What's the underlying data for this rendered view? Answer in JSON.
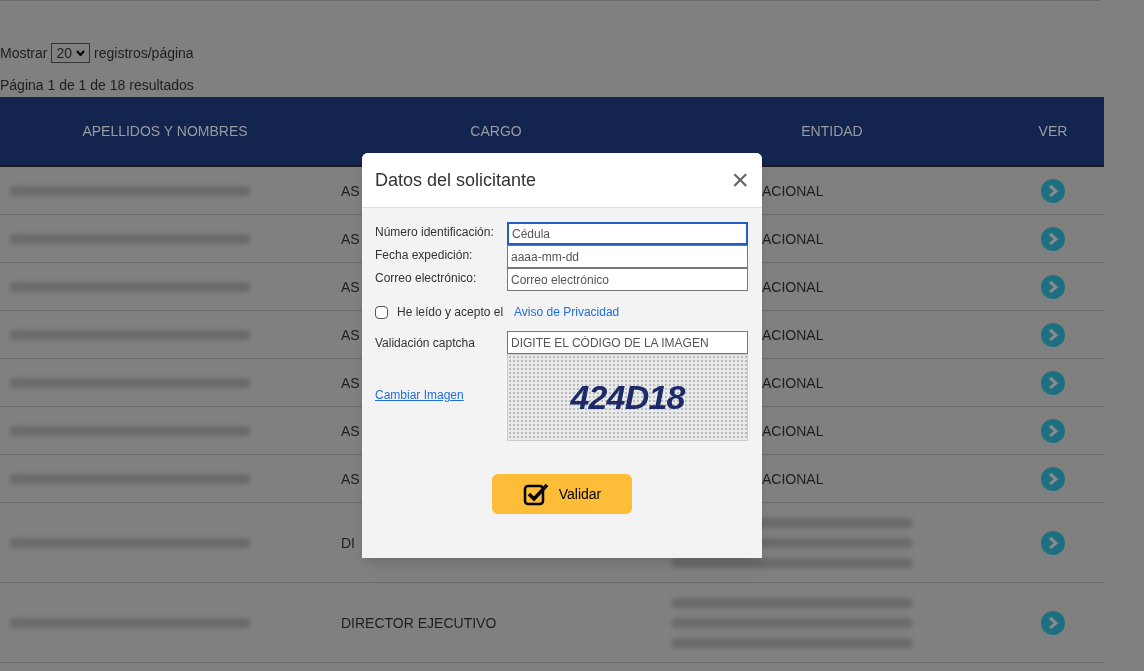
{
  "pager": {
    "show_label": "Mostrar",
    "page_size": "20",
    "per_page_label": "registros/página",
    "summary": "Página 1 de 1 de 18 resultados"
  },
  "table": {
    "columns": [
      "APELLIDOS Y NOMBRES",
      "CARGO",
      "ENTIDAD",
      "VER"
    ],
    "rows": [
      {
        "kind": "short",
        "cargo": "AS",
        "entidad": "ACIONAL"
      },
      {
        "kind": "short",
        "cargo": "AS",
        "entidad": "ACIONAL"
      },
      {
        "kind": "short",
        "cargo": "AS",
        "entidad": "ACIONAL"
      },
      {
        "kind": "short",
        "cargo": "AS",
        "entidad": "ACIONAL"
      },
      {
        "kind": "short",
        "cargo": "AS",
        "entidad": "ACIONAL"
      },
      {
        "kind": "short",
        "cargo": "AS",
        "entidad": "ACIONAL"
      },
      {
        "kind": "short",
        "cargo": "AS",
        "entidad": "ACIONAL"
      },
      {
        "kind": "tall",
        "cargo": "DI"
      },
      {
        "kind": "tall",
        "cargo": "DIRECTOR EJECUTIVO"
      }
    ]
  },
  "modal": {
    "title": "Datos del solicitante",
    "close": "×",
    "fields": [
      {
        "label": "Número identificación:",
        "placeholder": "Cédula",
        "focused": true
      },
      {
        "label": "Fecha expedición:",
        "placeholder": "aaaa-mm-dd",
        "focused": false
      },
      {
        "label": "Correo electrónico:",
        "placeholder": "Correo electrónico",
        "focused": false
      }
    ],
    "consent": {
      "checked": false,
      "text": "He leído y acepto el",
      "link": "Aviso de Privacidad"
    },
    "captcha": {
      "label": "Validación captcha",
      "placeholder": "DIGITE EL CÓDIGO DE LA IMAGEN",
      "change_link": "Cambiar Imagen",
      "code": "424D18"
    },
    "submit": "Validar"
  }
}
